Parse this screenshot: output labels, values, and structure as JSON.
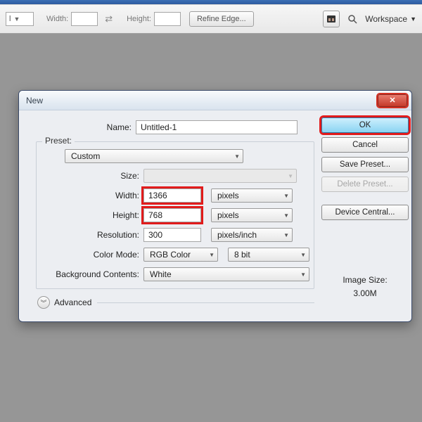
{
  "toolbar": {
    "width_label": "Width:",
    "height_label": "Height:",
    "refine_label": "Refine Edge...",
    "workspace_label": "Workspace"
  },
  "dialog": {
    "title": "New",
    "name_label": "Name:",
    "name_value": "Untitled-1",
    "preset_legend": "Preset:",
    "preset_value": "Custom",
    "size_label": "Size:",
    "width_label": "Width:",
    "width_value": "1366",
    "width_unit": "pixels",
    "height_label": "Height:",
    "height_value": "768",
    "height_unit": "pixels",
    "resolution_label": "Resolution:",
    "resolution_value": "300",
    "resolution_unit": "pixels/inch",
    "color_mode_label": "Color Mode:",
    "color_mode_value": "RGB Color",
    "color_depth": "8 bit",
    "bg_label": "Background Contents:",
    "bg_value": "White",
    "advanced_label": "Advanced",
    "ok": "OK",
    "cancel": "Cancel",
    "save_preset": "Save Preset...",
    "delete_preset": "Delete Preset...",
    "device_central": "Device Central...",
    "image_size_label": "Image Size:",
    "image_size_value": "3.00M"
  }
}
